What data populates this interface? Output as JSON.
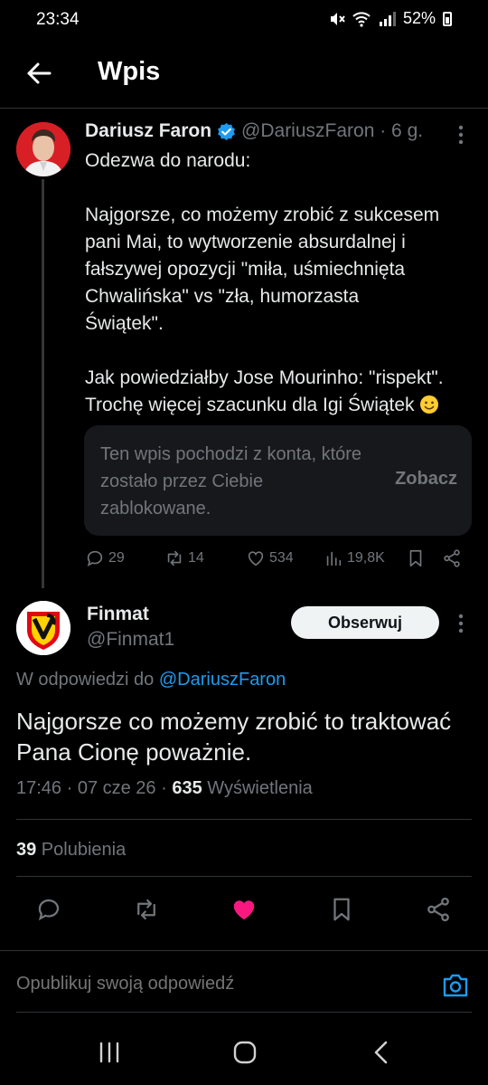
{
  "status_bar": {
    "time": "23:34",
    "battery": "52%"
  },
  "header": {
    "title": "Wpis"
  },
  "parent_tweet": {
    "author_name": "Dariusz Faron",
    "handle_time": "@DariuszFaron · 6 g.",
    "lines": [
      "Odezwa do narodu:",
      "",
      "Najgorsze, co możemy zrobić z sukcesem",
      "pani Mai, to wytworzenie absurdalnej i",
      "fałszywej opozycji \"miła, uśmiechnięta",
      "Chwalińska\" vs \"zła, humorzasta",
      "Świątek\".",
      "",
      "Jak powiedziałby Jose Mourinho: \"rispekt\".",
      "Trochę więcej szacunku dla Igi Świątek"
    ],
    "blocked_notice": "Ten wpis pochodzi z konta, które zostało przez Ciebie zablokowane.",
    "blocked_link": "Zobacz",
    "stats": {
      "replies": "29",
      "reposts": "14",
      "likes": "534",
      "views": "19,8K"
    }
  },
  "reply_tweet": {
    "author_name": "Finmat",
    "handle": "@Finmat1",
    "follow_label": "Obserwuj",
    "in_reply_prefix": "W odpowiedzi do ",
    "in_reply_mention": "@DariuszFaron",
    "text": "Najgorsze co możemy zrobić to traktować Pana Cionę poważnie.",
    "meta_prefix": "17:46 · 07 cze 26 · ",
    "views_count": "635",
    "views_label": " Wyświetlenia",
    "likes_count": "39",
    "likes_label": " Polubienia"
  },
  "reply_box": {
    "placeholder": "Opublikuj swoją odpowiedź"
  },
  "colors": {
    "accent": "#1d9bf0",
    "like": "#f91880",
    "background": "#000000",
    "muted": "#71767b"
  }
}
